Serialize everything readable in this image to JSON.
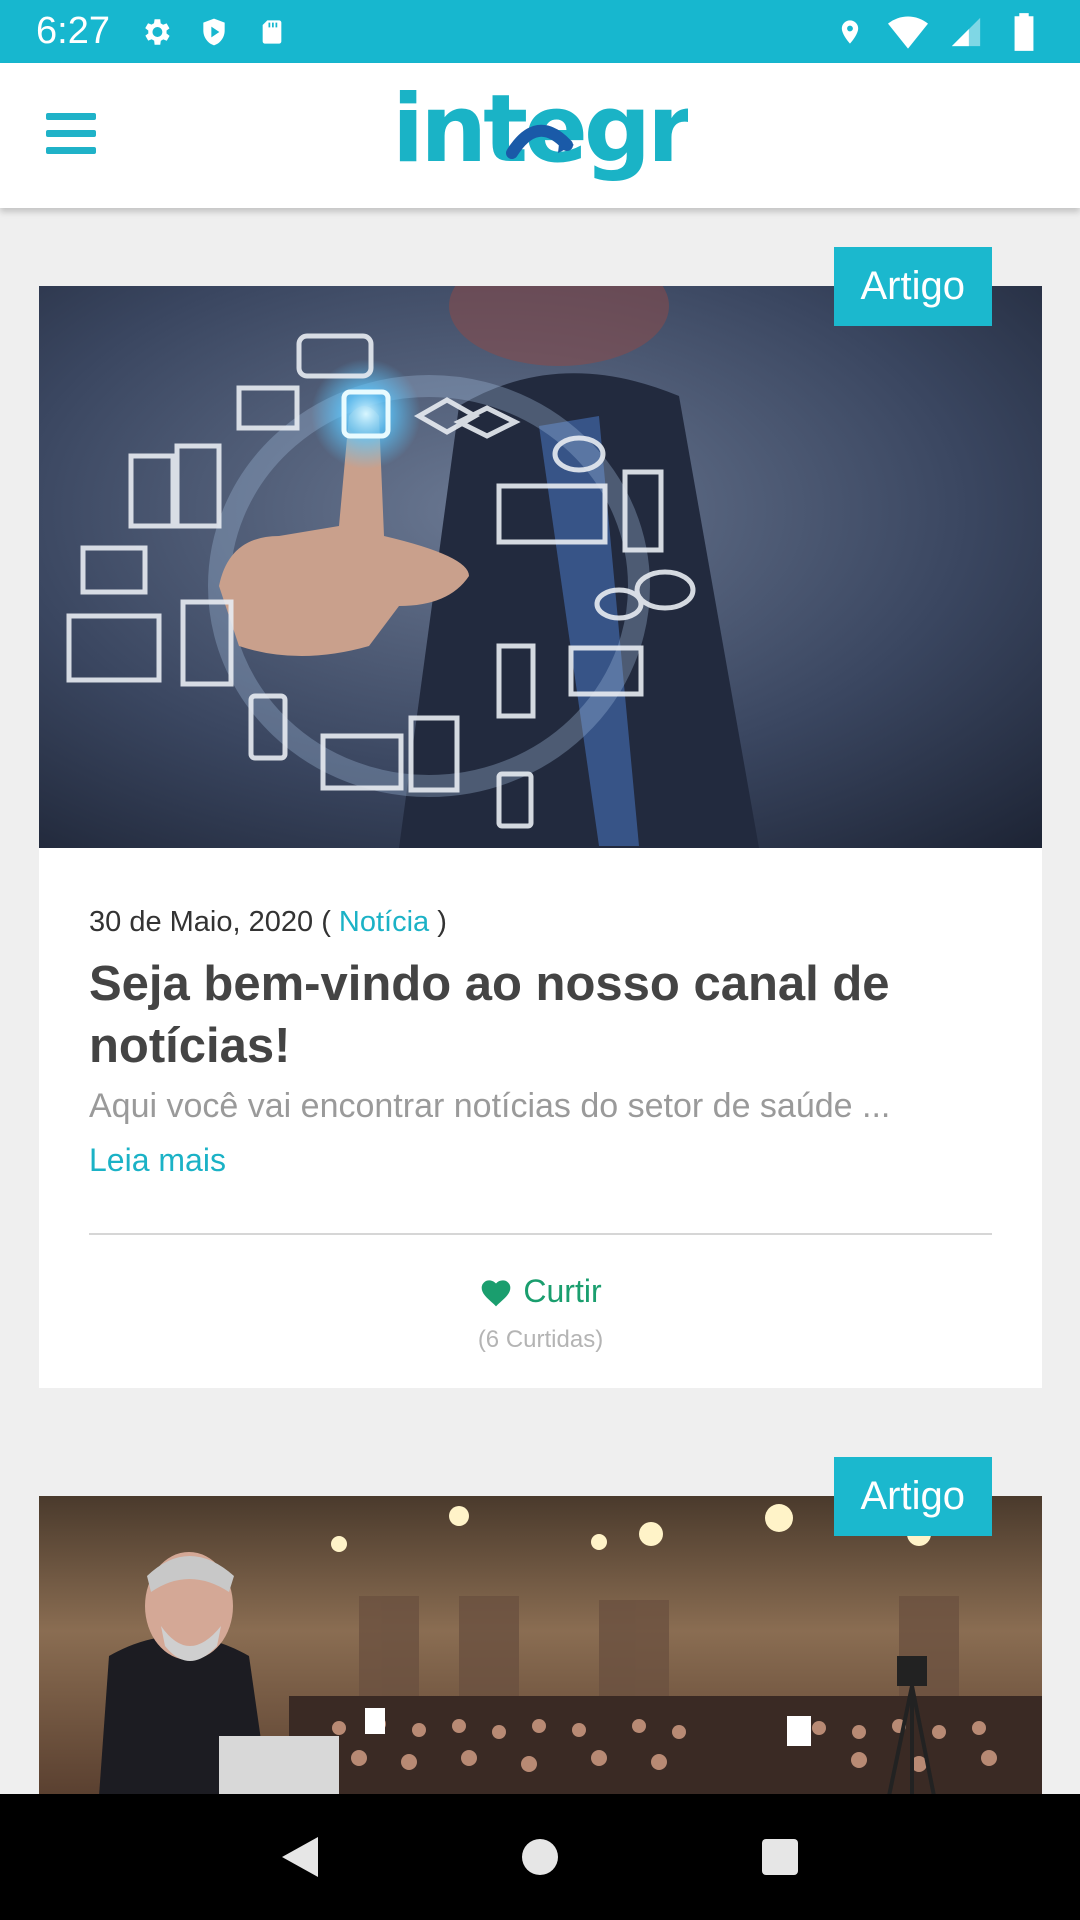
{
  "status_bar": {
    "time": "6:27",
    "left_icons": [
      "gear-icon",
      "shield-icon",
      "sd-card-icon"
    ],
    "right_icons": [
      "location-icon",
      "wifi-icon",
      "signal-icon",
      "battery-icon"
    ]
  },
  "app_bar": {
    "logo_text": "integra",
    "menu_icon": "hamburger-menu-icon"
  },
  "colors": {
    "accent": "#17b7cf",
    "like_green": "#1a9e6e",
    "logo_blue": "#1a5aa8"
  },
  "cards": [
    {
      "badge": "Artigo",
      "date": "30 de Maio, 2020",
      "paren_open": "(",
      "category": "Notícia",
      "paren_close": ")",
      "title": "Seja bem-vindo ao nosso canal de notícias!",
      "excerpt": "Aqui você vai encontrar notícias do setor de saúde ...",
      "read_more": "Leia mais",
      "like_label": "Curtir",
      "like_count": "(6 Curtidas)"
    },
    {
      "badge": "Artigo"
    }
  ],
  "nav_bar": {
    "buttons": [
      "back-icon",
      "home-icon",
      "recents-icon"
    ]
  }
}
